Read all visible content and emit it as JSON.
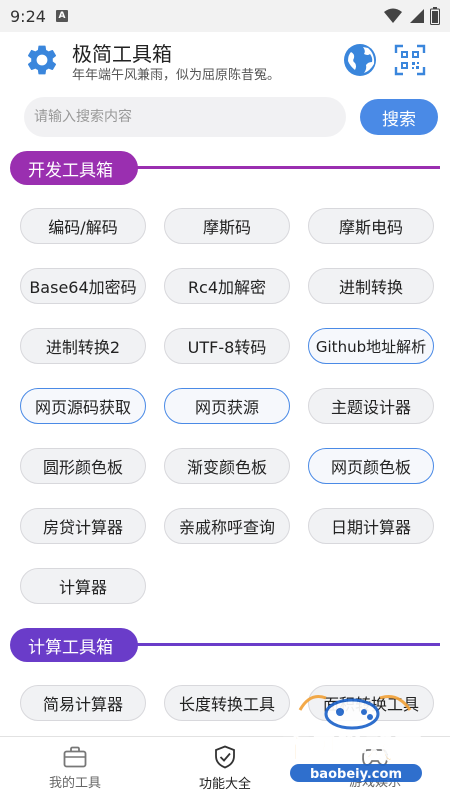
{
  "status_bar": {
    "time": "9:24",
    "notification_letter": "A"
  },
  "header": {
    "title": "极简工具箱",
    "subtitle": "年年端午风兼雨，似为屈原陈昔冤。",
    "icons": {
      "app": "gear-icon",
      "globe": "globe-icon",
      "scan": "qr-scan-icon"
    }
  },
  "search": {
    "placeholder": "请输入搜索内容",
    "value": "",
    "button_label": "搜索"
  },
  "colors": {
    "accent": "#4a8ae6",
    "section_dev": "#9a2fb0",
    "section_calc": "#6a3cc9",
    "button_bg": "#f1f2f4"
  },
  "sections": [
    {
      "title": "开发工具箱",
      "tools": [
        "编码/解码",
        "摩斯码",
        "摩斯电码",
        "Base64加密码",
        "Rc4加解密",
        "进制转换",
        "进制转换2",
        "UTF-8转码",
        "Github地址解析",
        "网页源码获取",
        "网页获源",
        "主题设计器",
        "圆形颜色板",
        "渐变颜色板",
        "网页颜色板",
        "房贷计算器",
        "亲戚称呼查询",
        "日期计算器",
        "计算器"
      ]
    },
    {
      "title": "计算工具箱",
      "tools": [
        "简易计算器",
        "长度转换工具",
        "面积转换工具"
      ]
    }
  ],
  "bottom_nav": [
    {
      "label": "我的工具",
      "icon": "briefcase-icon",
      "active": false
    },
    {
      "label": "功能大全",
      "icon": "shield-check-icon",
      "active": true
    },
    {
      "label": "游戏娱乐",
      "icon": "gamepad-icon",
      "active": false
    }
  ],
  "watermark": {
    "text": "宝贝游戏网",
    "url_text": "baobeiy.com"
  }
}
